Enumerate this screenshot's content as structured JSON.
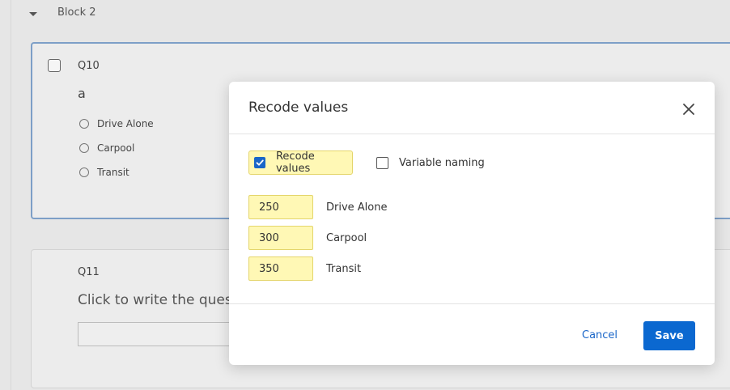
{
  "background": {
    "block_title": "Block 2",
    "q10": {
      "label": "Q10",
      "text": "a",
      "choices": [
        "Drive Alone",
        "Carpool",
        "Transit"
      ]
    },
    "q11": {
      "label": "Q11",
      "text": "Click to write the questi"
    }
  },
  "modal": {
    "title": "Recode values",
    "options": {
      "recode_values": {
        "label": "Recode values",
        "checked": true
      },
      "variable_naming": {
        "label": "Variable naming",
        "checked": false
      }
    },
    "recodes": [
      {
        "value": "250",
        "label": "Drive Alone"
      },
      {
        "value": "300",
        "label": "Carpool"
      },
      {
        "value": "350",
        "label": "Transit"
      }
    ],
    "cancel_label": "Cancel",
    "save_label": "Save"
  },
  "colors": {
    "accent": "#0b68d0",
    "highlight": "#fff8b5",
    "selected_border": "#7d9fc7"
  },
  "icons": {
    "close": "close-icon",
    "caret": "chevron-down-icon",
    "check": "checkmark-icon"
  }
}
